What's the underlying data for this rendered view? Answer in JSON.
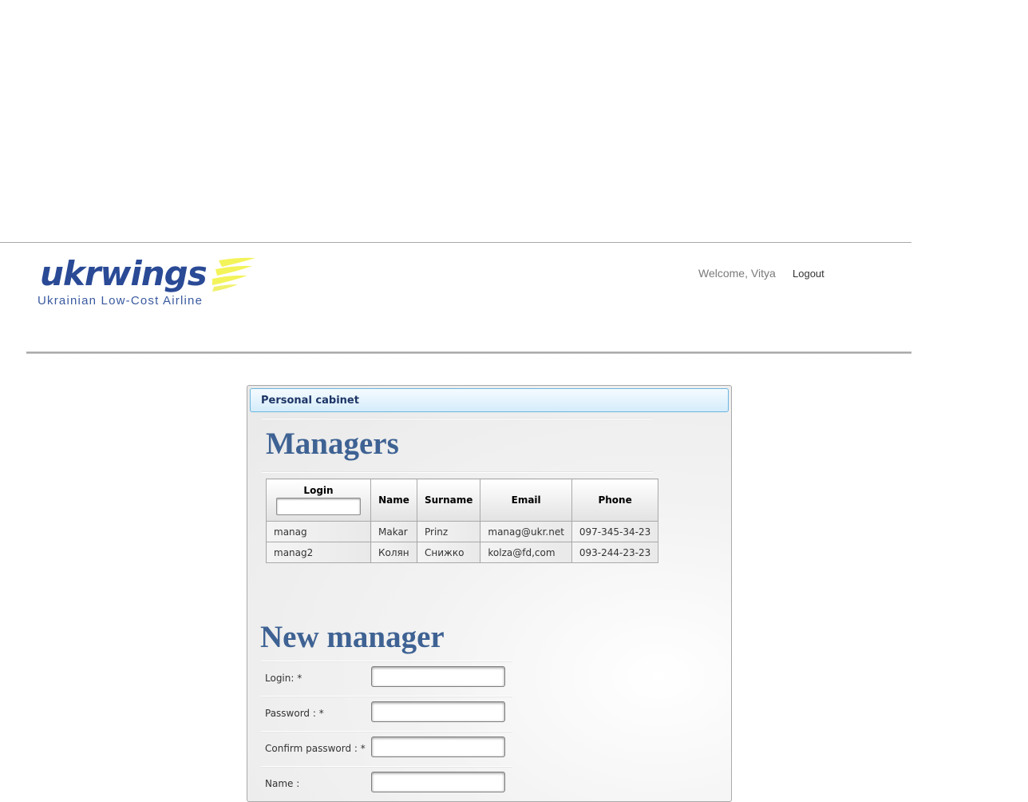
{
  "header": {
    "logo_word": "ukrwings",
    "logo_tagline": "Ukrainian Low-Cost Airline",
    "welcome_text": "Welcome, Vitya",
    "logout_label": "Logout"
  },
  "panel": {
    "title": "Personal cabinet"
  },
  "managers": {
    "title": "Managers",
    "columns": [
      "Login",
      "Name",
      "Surname",
      "Email",
      "Phone"
    ],
    "rows": [
      [
        "manag",
        "Makar",
        "Prinz",
        "manag@ukr.net",
        "097-345-34-23"
      ],
      [
        "manag2",
        "Колян",
        "Снижко",
        "kolza@fd,com",
        "093-244-23-23"
      ]
    ]
  },
  "new_manager": {
    "title": "New manager",
    "fields": [
      {
        "label": "Login: *"
      },
      {
        "label": "Password : *"
      },
      {
        "label": "Confirm password : *"
      },
      {
        "label": "Name :"
      }
    ]
  },
  "colors": {
    "logo_blue": "#2a4a96",
    "logo_yellow": "#f3f35a",
    "section_title": "#3e6293",
    "panel_header_border": "#6ab6e0"
  }
}
